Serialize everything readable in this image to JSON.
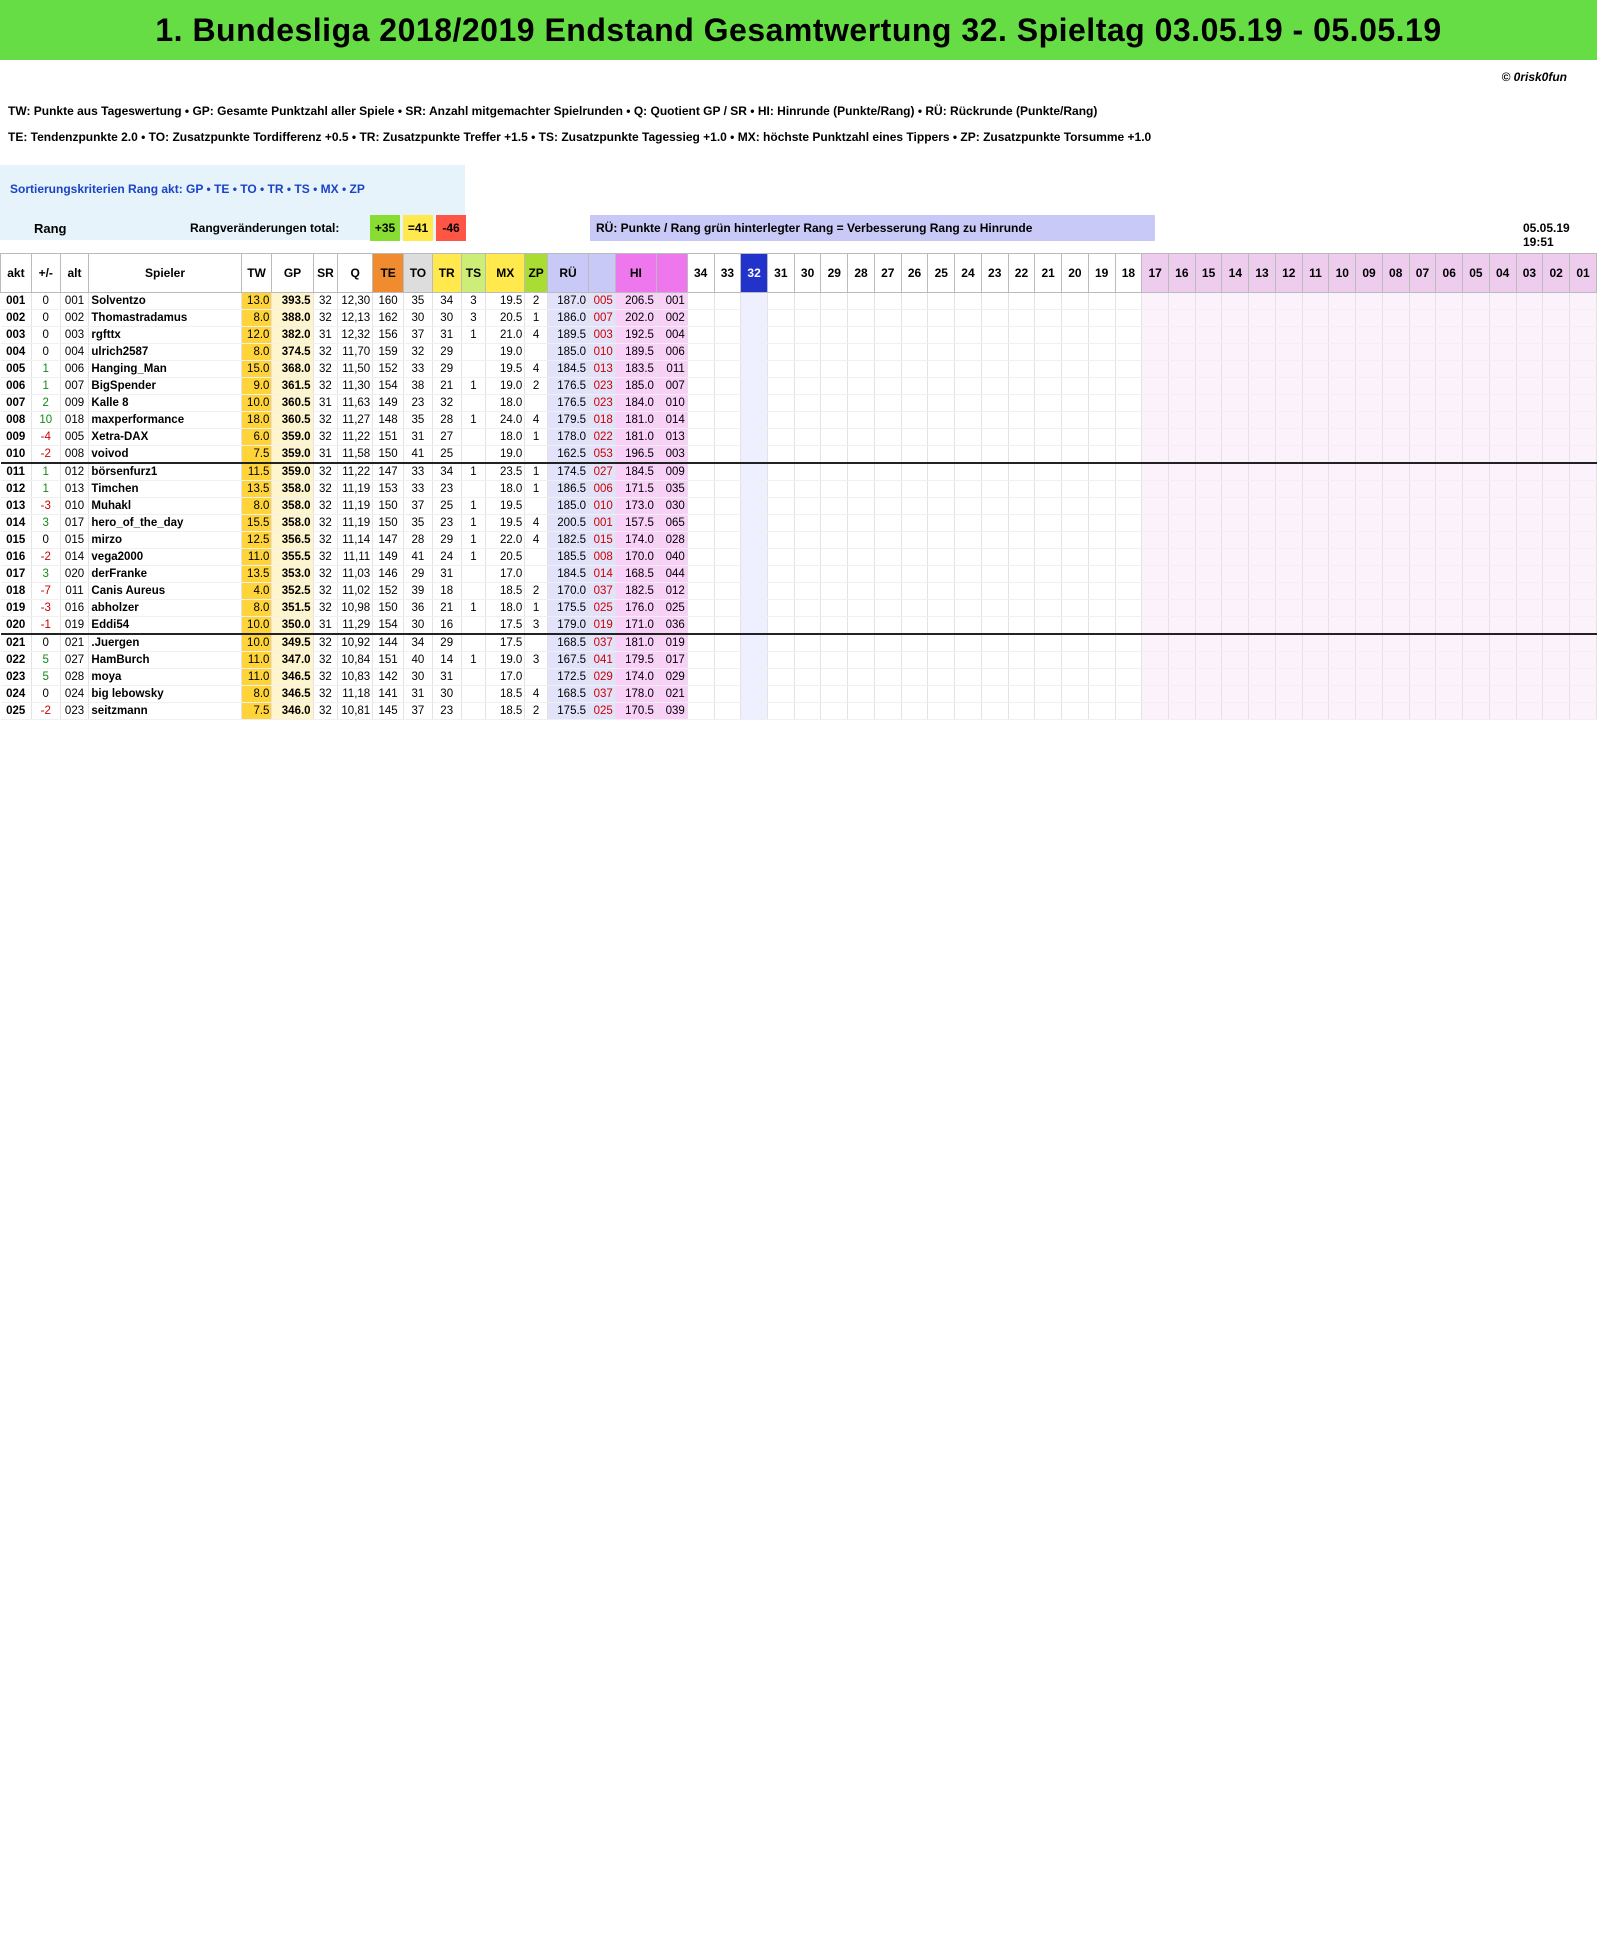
{
  "title": "1. Bundesliga 2018/2019   Endstand Gesamtwertung   32. Spieltag   03.05.19 - 05.05.19",
  "copyright": "© 0risk0fun",
  "legend_line1": "TW:  Punkte aus Tageswertung   •   GP: Gesamte Punktzahl aller Spiele   •   SR: Anzahl mitgemachter Spielrunden   •   Q: Quotient GP / SR   •   HI: Hinrunde (Punkte/Rang)   •   RÜ: Rückrunde (Punkte/Rang)",
  "legend_line2": "TE:  Tendenzpunkte 2.0   •   TO: Zusatzpunkte Tordifferenz +0.5   •   TR: Zusatzpunkte Treffer +1.5   •   TS: Zusatzpunkte Tagessieg +1.0   •   MX: höchste Punktzahl eines Tippers   •   ZP: Zusatzpunkte Torsumme +1.0",
  "sort_criteria": "Sortierungskriterien Rang akt:  GP  •  TE  •  TO  •  TR  •  TS  •  MX  •  ZP",
  "rang_label": "Rang",
  "rang_changes_label": "Rangveränderungen total:",
  "rang_changes": {
    "plus": "+35",
    "equal": "=41",
    "minus": "-46"
  },
  "ru_note": "RÜ: Punkte / Rang   grün hinterlegter Rang = Verbesserung Rang zu Hinrunde",
  "timestamp": "05.05.19   19:51",
  "columns": [
    "akt",
    "+/-",
    "alt",
    "Spieler",
    "TW",
    "GP",
    "SR",
    "Q",
    "TE",
    "TO",
    "TR",
    "TS",
    "MX",
    "ZP",
    "RÜ",
    "",
    "HI",
    ""
  ],
  "rounds": [
    "34",
    "33",
    "32",
    "31",
    "30",
    "29",
    "28",
    "27",
    "26",
    "25",
    "24",
    "23",
    "22",
    "21",
    "20",
    "19",
    "18",
    "17",
    "16",
    "15",
    "14",
    "13",
    "12",
    "11",
    "10",
    "09",
    "08",
    "07",
    "06",
    "05",
    "04",
    "03",
    "02",
    "01"
  ],
  "rows": [
    {
      "akt": "001",
      "d": "0",
      "alt": "001",
      "name": "Solventzo",
      "tw": "13.0",
      "gp": "393.5",
      "sr": "32",
      "q": "12,30",
      "te": "160",
      "to": "35",
      "tr": "34",
      "ts": "3",
      "mx": "19.5",
      "zp": "2",
      "ru": "187.0",
      "rur": "005",
      "hi": "206.5",
      "hir": "001"
    },
    {
      "akt": "002",
      "d": "0",
      "alt": "002",
      "name": "Thomastradamus",
      "tw": "8.0",
      "gp": "388.0",
      "sr": "32",
      "q": "12,13",
      "te": "162",
      "to": "30",
      "tr": "30",
      "ts": "3",
      "mx": "20.5",
      "zp": "1",
      "ru": "186.0",
      "rur": "007",
      "hi": "202.0",
      "hir": "002"
    },
    {
      "akt": "003",
      "d": "0",
      "alt": "003",
      "name": "rgfttx",
      "tw": "12.0",
      "gp": "382.0",
      "sr": "31",
      "q": "12,32",
      "te": "156",
      "to": "37",
      "tr": "31",
      "ts": "1",
      "mx": "21.0",
      "zp": "4",
      "ru": "189.5",
      "rur": "003",
      "hi": "192.5",
      "hir": "004"
    },
    {
      "akt": "004",
      "d": "0",
      "alt": "004",
      "name": "ulrich2587",
      "tw": "8.0",
      "gp": "374.5",
      "sr": "32",
      "q": "11,70",
      "te": "159",
      "to": "32",
      "tr": "29",
      "ts": "",
      "mx": "19.0",
      "zp": "",
      "ru": "185.0",
      "rur": "010",
      "hi": "189.5",
      "hir": "006"
    },
    {
      "akt": "005",
      "d": "1",
      "alt": "006",
      "name": "Hanging_Man",
      "tw": "15.0",
      "gp": "368.0",
      "sr": "32",
      "q": "11,50",
      "te": "152",
      "to": "33",
      "tr": "29",
      "ts": "",
      "mx": "19.5",
      "zp": "4",
      "ru": "184.5",
      "rur": "013",
      "hi": "183.5",
      "hir": "011"
    },
    {
      "akt": "006",
      "d": "1",
      "alt": "007",
      "name": "BigSpender",
      "tw": "9.0",
      "gp": "361.5",
      "sr": "32",
      "q": "11,30",
      "te": "154",
      "to": "38",
      "tr": "21",
      "ts": "1",
      "mx": "19.0",
      "zp": "2",
      "ru": "176.5",
      "rur": "023",
      "hi": "185.0",
      "hir": "007"
    },
    {
      "akt": "007",
      "d": "2",
      "alt": "009",
      "name": "Kalle 8",
      "tw": "10.0",
      "gp": "360.5",
      "sr": "31",
      "q": "11,63",
      "te": "149",
      "to": "23",
      "tr": "32",
      "ts": "",
      "mx": "18.0",
      "zp": "",
      "ru": "176.5",
      "rur": "023",
      "hi": "184.0",
      "hir": "010"
    },
    {
      "akt": "008",
      "d": "10",
      "alt": "018",
      "name": "maxperformance",
      "tw": "18.0",
      "gp": "360.5",
      "sr": "32",
      "q": "11,27",
      "te": "148",
      "to": "35",
      "tr": "28",
      "ts": "1",
      "mx": "24.0",
      "zp": "4",
      "ru": "179.5",
      "rur": "018",
      "hi": "181.0",
      "hir": "014"
    },
    {
      "akt": "009",
      "d": "-4",
      "alt": "005",
      "name": "Xetra-DAX",
      "tw": "6.0",
      "gp": "359.0",
      "sr": "32",
      "q": "11,22",
      "te": "151",
      "to": "31",
      "tr": "27",
      "ts": "",
      "mx": "18.0",
      "zp": "1",
      "ru": "178.0",
      "rur": "022",
      "hi": "181.0",
      "hir": "013"
    },
    {
      "akt": "010",
      "d": "-2",
      "alt": "008",
      "name": "voivod",
      "tw": "7.5",
      "gp": "359.0",
      "sr": "31",
      "q": "11,58",
      "te": "150",
      "to": "41",
      "tr": "25",
      "ts": "",
      "mx": "19.0",
      "zp": "",
      "ru": "162.5",
      "rur": "053",
      "hi": "196.5",
      "hir": "003"
    },
    {
      "akt": "011",
      "d": "1",
      "alt": "012",
      "name": "börsenfurz1",
      "tw": "11.5",
      "gp": "359.0",
      "sr": "32",
      "q": "11,22",
      "te": "147",
      "to": "33",
      "tr": "34",
      "ts": "1",
      "mx": "23.5",
      "zp": "1",
      "ru": "174.5",
      "rur": "027",
      "hi": "184.5",
      "hir": "009"
    },
    {
      "akt": "012",
      "d": "1",
      "alt": "013",
      "name": "Timchen",
      "tw": "13.5",
      "gp": "358.0",
      "sr": "32",
      "q": "11,19",
      "te": "153",
      "to": "33",
      "tr": "23",
      "ts": "",
      "mx": "18.0",
      "zp": "1",
      "ru": "186.5",
      "rur": "006",
      "hi": "171.5",
      "hir": "035"
    },
    {
      "akt": "013",
      "d": "-3",
      "alt": "010",
      "name": "Muhakl",
      "tw": "8.0",
      "gp": "358.0",
      "sr": "32",
      "q": "11,19",
      "te": "150",
      "to": "37",
      "tr": "25",
      "ts": "1",
      "mx": "19.5",
      "zp": "",
      "ru": "185.0",
      "rur": "010",
      "hi": "173.0",
      "hir": "030"
    },
    {
      "akt": "014",
      "d": "3",
      "alt": "017",
      "name": "hero_of_the_day",
      "tw": "15.5",
      "gp": "358.0",
      "sr": "32",
      "q": "11,19",
      "te": "150",
      "to": "35",
      "tr": "23",
      "ts": "1",
      "mx": "19.5",
      "zp": "4",
      "ru": "200.5",
      "rur": "001",
      "hi": "157.5",
      "hir": "065"
    },
    {
      "akt": "015",
      "d": "0",
      "alt": "015",
      "name": "mirzo",
      "tw": "12.5",
      "gp": "356.5",
      "sr": "32",
      "q": "11,14",
      "te": "147",
      "to": "28",
      "tr": "29",
      "ts": "1",
      "mx": "22.0",
      "zp": "4",
      "ru": "182.5",
      "rur": "015",
      "hi": "174.0",
      "hir": "028"
    },
    {
      "akt": "016",
      "d": "-2",
      "alt": "014",
      "name": "vega2000",
      "tw": "11.0",
      "gp": "355.5",
      "sr": "32",
      "q": "11,11",
      "te": "149",
      "to": "41",
      "tr": "24",
      "ts": "1",
      "mx": "20.5",
      "zp": "",
      "ru": "185.5",
      "rur": "008",
      "hi": "170.0",
      "hir": "040"
    },
    {
      "akt": "017",
      "d": "3",
      "alt": "020",
      "name": "derFranke",
      "tw": "13.5",
      "gp": "353.0",
      "sr": "32",
      "q": "11,03",
      "te": "146",
      "to": "29",
      "tr": "31",
      "ts": "",
      "mx": "17.0",
      "zp": "",
      "ru": "184.5",
      "rur": "014",
      "hi": "168.5",
      "hir": "044"
    },
    {
      "akt": "018",
      "d": "-7",
      "alt": "011",
      "name": "Canis Aureus",
      "tw": "4.0",
      "gp": "352.5",
      "sr": "32",
      "q": "11,02",
      "te": "152",
      "to": "39",
      "tr": "18",
      "ts": "",
      "mx": "18.5",
      "zp": "2",
      "ru": "170.0",
      "rur": "037",
      "hi": "182.5",
      "hir": "012"
    },
    {
      "akt": "019",
      "d": "-3",
      "alt": "016",
      "name": "abholzer",
      "tw": "8.0",
      "gp": "351.5",
      "sr": "32",
      "q": "10,98",
      "te": "150",
      "to": "36",
      "tr": "21",
      "ts": "1",
      "mx": "18.0",
      "zp": "1",
      "ru": "175.5",
      "rur": "025",
      "hi": "176.0",
      "hir": "025"
    },
    {
      "akt": "020",
      "d": "-1",
      "alt": "019",
      "name": "Eddi54",
      "tw": "10.0",
      "gp": "350.0",
      "sr": "31",
      "q": "11,29",
      "te": "154",
      "to": "30",
      "tr": "16",
      "ts": "",
      "mx": "17.5",
      "zp": "3",
      "ru": "179.0",
      "rur": "019",
      "hi": "171.0",
      "hir": "036"
    },
    {
      "akt": "021",
      "d": "0",
      "alt": "021",
      "name": ".Juergen",
      "tw": "10.0",
      "gp": "349.5",
      "sr": "32",
      "q": "10,92",
      "te": "144",
      "to": "34",
      "tr": "29",
      "ts": "",
      "mx": "17.5",
      "zp": "",
      "ru": "168.5",
      "rur": "037",
      "hi": "181.0",
      "hir": "019"
    },
    {
      "akt": "022",
      "d": "5",
      "alt": "027",
      "name": "HamBurch",
      "tw": "11.0",
      "gp": "347.0",
      "sr": "32",
      "q": "10,84",
      "te": "151",
      "to": "40",
      "tr": "14",
      "ts": "1",
      "mx": "19.0",
      "zp": "3",
      "ru": "167.5",
      "rur": "041",
      "hi": "179.5",
      "hir": "017"
    },
    {
      "akt": "023",
      "d": "5",
      "alt": "028",
      "name": "moya",
      "tw": "11.0",
      "gp": "346.5",
      "sr": "32",
      "q": "10,83",
      "te": "142",
      "to": "30",
      "tr": "31",
      "ts": "",
      "mx": "17.0",
      "zp": "",
      "ru": "172.5",
      "rur": "029",
      "hi": "174.0",
      "hir": "029"
    },
    {
      "akt": "024",
      "d": "0",
      "alt": "024",
      "name": "big lebowsky",
      "tw": "8.0",
      "gp": "346.5",
      "sr": "32",
      "q": "11,18",
      "te": "141",
      "to": "31",
      "tr": "30",
      "ts": "",
      "mx": "18.5",
      "zp": "4",
      "ru": "168.5",
      "rur": "037",
      "hi": "178.0",
      "hir": "021"
    },
    {
      "akt": "025",
      "d": "-2",
      "alt": "023",
      "name": "seitzmann",
      "tw": "7.5",
      "gp": "346.0",
      "sr": "32",
      "q": "10,81",
      "te": "145",
      "to": "37",
      "tr": "23",
      "ts": "",
      "mx": "18.5",
      "zp": "2",
      "ru": "175.5",
      "rur": "025",
      "hi": "170.5",
      "hir": "039"
    }
  ],
  "more_note": "…"
}
